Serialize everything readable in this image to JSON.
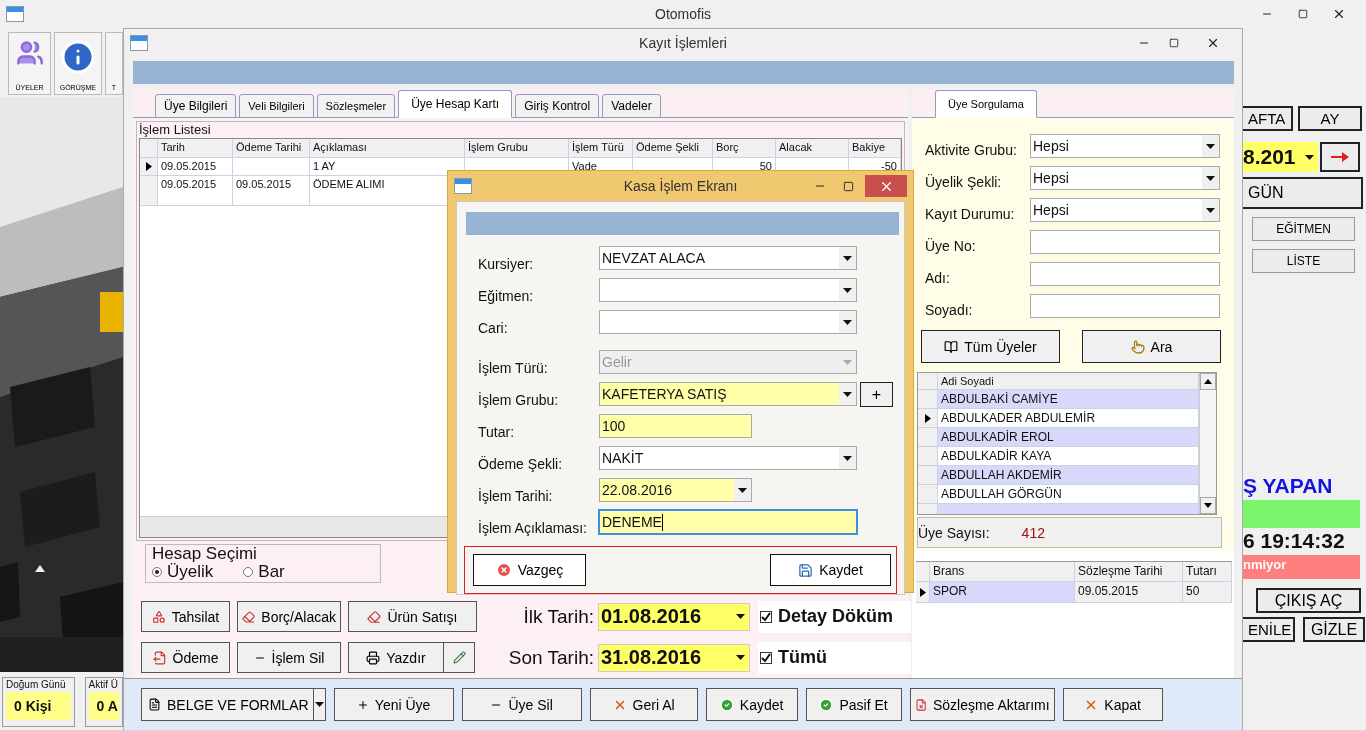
{
  "main_window": {
    "title": "Otomofis"
  },
  "toolbar": [
    {
      "label": "ÜYELER"
    },
    {
      "label": "GÖRÜŞME"
    },
    {
      "label": "T"
    }
  ],
  "counters": [
    {
      "title": "Doğum Günü",
      "value": "0 Kişi"
    },
    {
      "title": "Aktif Ü",
      "value": "0 A"
    }
  ],
  "side_panel": {
    "period_buttons": [
      "AFTA",
      "AY"
    ],
    "date": "8.201",
    "day_button": "GÜN",
    "list_buttons": [
      "EĞİTMEN",
      "LİSTE"
    ],
    "heading": "Ş YAPAN",
    "clock": "6 19:14:32",
    "status": "nmiyor",
    "exit_button": "ÇIKIŞ AÇ",
    "bottom_buttons": [
      "ENİLE",
      "GİZLE"
    ]
  },
  "record_window": {
    "title": "Kayıt İşlemleri",
    "tabs": [
      {
        "label": "Üye Bilgileri",
        "selected": false
      },
      {
        "label": "Veli Bilgileri",
        "selected": false
      },
      {
        "label": "Sözleşmeler",
        "selected": false
      },
      {
        "label": "Üye Hesap Kartı",
        "selected": true
      },
      {
        "label": "Giriş Kontrol",
        "selected": false
      },
      {
        "label": "Vadeler",
        "selected": false
      }
    ],
    "transactions": {
      "title": "İşlem Listesi",
      "columns": [
        "Tarih",
        "Ödeme Tarihi",
        "Açıklaması",
        "İşlem Grubu",
        "İşlem Türü",
        "Ödeme Şekli",
        "Borç",
        "Alacak",
        "Bakiye"
      ],
      "rows": [
        {
          "selected": true,
          "cells": [
            "09.05.2015",
            "",
            "1 AY",
            "",
            "Vade",
            "",
            "50",
            "",
            "-50"
          ]
        },
        {
          "selected": false,
          "cells": [
            "09.05.2015",
            "09.05.2015",
            "ÖDEME ALIMI"
          ]
        }
      ]
    },
    "account_selection": {
      "title": "Hesap Seçimi",
      "options": [
        {
          "label": "Üyelik",
          "selected": true
        },
        {
          "label": "Bar",
          "selected": false
        }
      ]
    },
    "action_buttons": [
      "Tahsilat",
      "Borç/Alacak",
      "Ürün Satışı",
      "Ödeme",
      "İşlem Sil",
      "Yazdır"
    ],
    "date_range": [
      {
        "label": "İlk Tarih:",
        "value": "01.08.2016",
        "option": {
          "label": "Detay Döküm",
          "checked": true
        }
      },
      {
        "label": "Son Tarih:",
        "value": "31.08.2016",
        "option": {
          "label": "Tümü",
          "checked": true
        }
      }
    ],
    "bottom_buttons": [
      {
        "label": "BELGE VE FORMLAR",
        "kind": "split"
      },
      {
        "label": "Yeni Üye",
        "kind": "plain"
      },
      {
        "label": "Üye Sil",
        "kind": "plain"
      },
      {
        "label": "Geri Al",
        "kind": "plain"
      },
      {
        "label": "Kaydet",
        "kind": "plain"
      },
      {
        "label": "Pasif Et",
        "kind": "plain"
      },
      {
        "label": "Sözleşme Aktarımı",
        "kind": "plain"
      },
      {
        "label": "Kapat",
        "kind": "plain"
      }
    ],
    "search": {
      "tab": {
        "label": "Üye Sorgulama",
        "selected": true
      },
      "filters": [
        {
          "label": "Aktivite Grubu:",
          "kind": "select",
          "value": "Hepsi"
        },
        {
          "label": "Üyelik Şekli:",
          "kind": "select",
          "value": "Hepsi"
        },
        {
          "label": "Kayıt Durumu:",
          "kind": "select",
          "value": "Hepsi"
        },
        {
          "label": "Üye No:",
          "kind": "text"
        },
        {
          "label": "Adı:",
          "kind": "text"
        },
        {
          "label": "Soyadı:",
          "kind": "text"
        }
      ],
      "buttons": [
        "Tüm Üyeler",
        "Ara"
      ],
      "members": {
        "column": "Adi Soyadi",
        "rows": [
          {
            "name": "ABDULBAKİ CAMİYE",
            "selected": false
          },
          {
            "name": "ABDULKADER ABDULEMİR",
            "selected": true
          },
          {
            "name": "ABDULKADİR EROL",
            "selected": false
          },
          {
            "name": "ABDULKADİR KAYA",
            "selected": false
          },
          {
            "name": "ABDULLAH AKDEMİR",
            "selected": false
          },
          {
            "name": "ABDULLAH GÖRGÜN",
            "selected": false
          }
        ]
      },
      "count": {
        "label": "Üye Sayısı:",
        "value": "412"
      },
      "contracts": {
        "columns": [
          "Brans",
          "Sözleşme Tarihi",
          "Tutarı"
        ],
        "rows": [
          {
            "selected": true,
            "cells": [
              "SPOR",
              "09.05.2015",
              "50"
            ]
          }
        ]
      }
    }
  },
  "cash_dialog": {
    "title": "Kasa İşlem Ekranı",
    "fields": [
      {
        "label": "Kursiyer:",
        "kind": "select",
        "value": "NEVZAT ALACA",
        "highlighted": false,
        "disabled": false
      },
      {
        "label": "Eğitmen:",
        "kind": "select",
        "highlighted": false,
        "disabled": false
      },
      {
        "label": "Cari:",
        "kind": "select",
        "highlighted": false,
        "disabled": false
      },
      {
        "label": "İşlem Türü:",
        "kind": "select",
        "value": "Gelir",
        "highlighted": false,
        "disabled": true
      },
      {
        "label": "İşlem Grubu:",
        "kind": "select",
        "value": "KAFETERYA SATIŞ",
        "highlighted": true,
        "disabled": false,
        "add_button": "+"
      },
      {
        "label": "Tutar:",
        "kind": "short_text",
        "value": "100",
        "highlighted": true,
        "disabled": false
      },
      {
        "label": "Ödeme Şekli:",
        "kind": "select",
        "value": "NAKİT",
        "highlighted": false,
        "disabled": false
      },
      {
        "label": "İşlem Tarihi:",
        "kind": "date",
        "value": "22.08.2016",
        "highlighted": true,
        "disabled": false
      },
      {
        "label": "İşlem Açıklaması:",
        "kind": "text",
        "value": "DENEME",
        "highlighted": true,
        "disabled": false,
        "focused": true
      }
    ],
    "buttons": [
      "Vazgeç",
      "Kaydet"
    ]
  }
}
